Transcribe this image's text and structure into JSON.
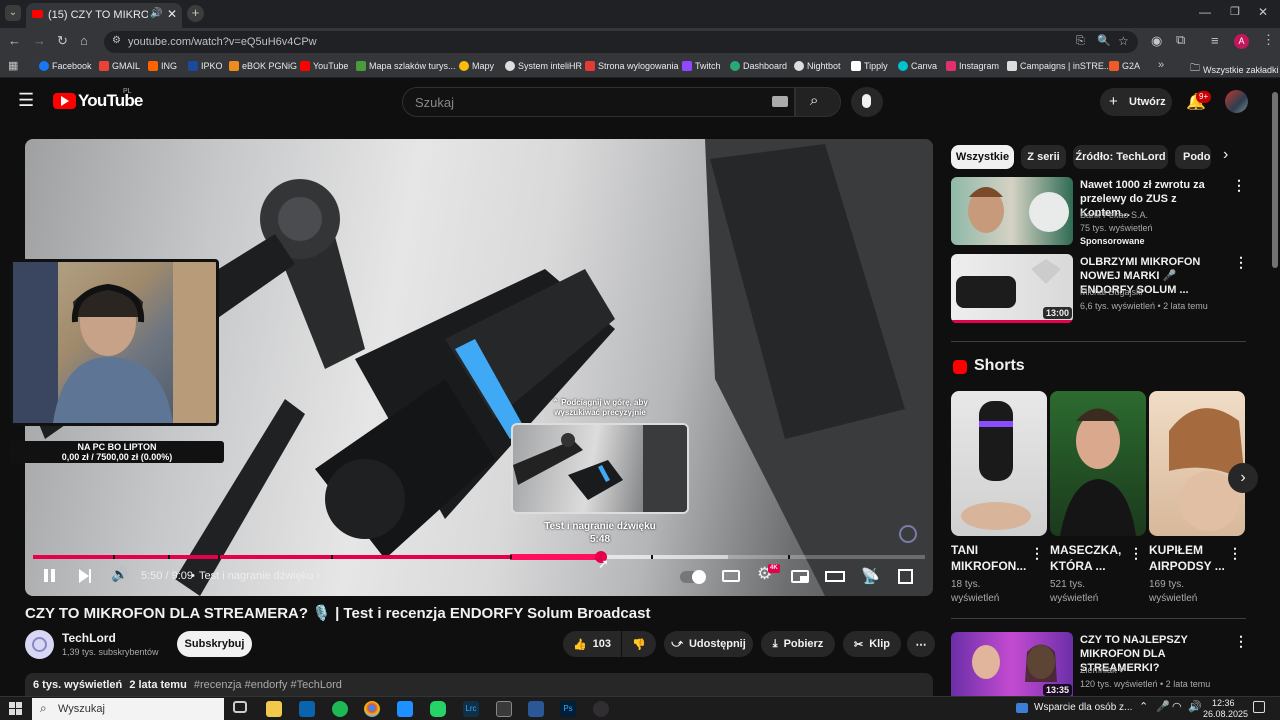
{
  "browser": {
    "tab_title": "(15) CZY TO MIKROFON DL",
    "url": "youtube.com/watch?v=eQ5uH6v4CPw",
    "bookmarks": [
      "Facebook",
      "GMAIL",
      "ING",
      "IPKO",
      "eBOK PGNiG",
      "YouTube",
      "Mapa szlaków turys...",
      "Mapy",
      "System inteliHR",
      "Strona wylogowania",
      "Twitch",
      "Dashboard",
      "Nightbot",
      "Tipply",
      "Canva",
      "Instagram",
      "Campaigns | inSTRE...",
      "G2A"
    ],
    "all_bookmarks": "Wszystkie zakładki",
    "profile_initial": "A"
  },
  "header": {
    "logo": "YouTube",
    "region": "PL",
    "search_placeholder": "Szukaj",
    "create_label": "Utwórz",
    "notification_count": "9+"
  },
  "player": {
    "overlay_name": "NA PC BO LIPTON",
    "overlay_goal": "0,00 zł / 7500,00 zł (0.00%)",
    "seek_hint": "Podciągnij w górę, aby wyszukiwać precyzyjnie",
    "preview_chapter": "Test i nagranie dźwięku",
    "preview_time": "5:48",
    "time": "5:50 / 9:09",
    "chapter": "Test i nagranie dźwięku",
    "progress": 0.637,
    "settings_badge": "4K"
  },
  "video": {
    "title": "CZY TO MIKROFON DLA STREAMERA? 🎙️ | Test i recenzja ENDORFY Solum Broadcast",
    "channel": "TechLord",
    "subscribers": "1,39 tys. subskrybentów",
    "subscribe_label": "Subskrybuj",
    "likes": "103",
    "share_label": "Udostępnij",
    "download_label": "Pobierz",
    "clip_label": "Klip",
    "views": "6 tys. wyświetleń",
    "age": "2 lata temu",
    "hashtags": "#recenzja #endorfy #TechLord"
  },
  "sidebar": {
    "chips": [
      "Wszystkie",
      "Z serii",
      "Źródło: TechLord",
      "Podo"
    ],
    "recs": [
      {
        "title": "Nawet 1000 zł zwrotu za przelewy do ZUS z Kontem...",
        "channel": "Bank Pekao S.A.",
        "meta": "75 tys. wyświetleń",
        "badge": "Sponsorowane"
      },
      {
        "title": "OLBRZYMI MIKROFON NOWEJ MARKI 🎤 ENDORFY SOLUM ...",
        "channel": "Michał Bugajski",
        "meta": "6,6 tys. wyświetleń • 2 lata temu",
        "duration": "13:00"
      }
    ],
    "shorts_heading": "Shorts",
    "shorts": [
      {
        "title": "TANI MIKROFON...",
        "views": "18 tys. wyświetleń"
      },
      {
        "title": "MASECZKA, KTÓRA ...",
        "views": "521 tys. wyświetleń"
      },
      {
        "title": "KUPIŁEM AIRPODSY ...",
        "views": "169 tys. wyświetleń"
      }
    ],
    "rec3": {
      "title": "CZY TO NAJLEPSZY MIKROFON DLA STREAMERKI?",
      "channel": "Ziemniak",
      "meta": "120 tys. wyświetleń • 2 lata temu",
      "duration": "13:35"
    }
  },
  "taskbar": {
    "search": "Wyszukaj",
    "notice": "Wsparcie dla osób z...",
    "time": "12:36",
    "date": "26.08.2025"
  },
  "colors": {
    "accent": "#e5004b",
    "bg": "#0f0f0f",
    "chip": "#272727"
  }
}
